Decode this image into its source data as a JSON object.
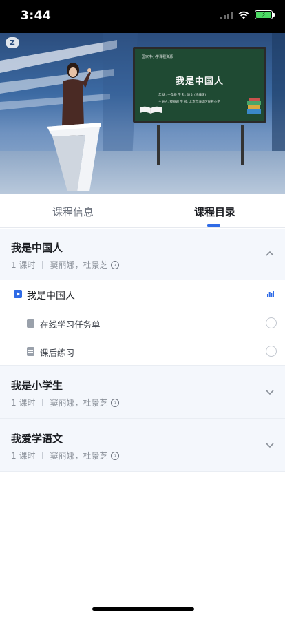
{
  "status_bar": {
    "time": "3:44",
    "battery_color": "#4cd964"
  },
  "video": {
    "board_header": "国家中小学课程资源",
    "board_title": "我是中国人",
    "board_line1": "年 级: 一年级    学 科: 语文 (统编版)",
    "board_line2": "主讲人: 窦丽娜    学 校: 北京市海淀区民族小学",
    "logo_glyph": "Z"
  },
  "tabs": {
    "info_label": "课程信息",
    "catalog_label": "课程目录",
    "active_tab": "课程目录",
    "accent_color": "#2f6be6"
  },
  "units": [
    {
      "title": "我是中国人",
      "lessons_count": "1 课时",
      "teachers": "窦丽娜，杜景芝",
      "expanded": true,
      "lesson": {
        "title": "我是中国人",
        "items": [
          {
            "title": "在线学习任务单"
          },
          {
            "title": "课后练习"
          }
        ]
      }
    },
    {
      "title": "我是小学生",
      "lessons_count": "1 课时",
      "teachers": "窦丽娜，杜景芝",
      "expanded": false
    },
    {
      "title": "我爱学语文",
      "lessons_count": "1 课时",
      "teachers": "窦丽娜，杜景芝",
      "expanded": false
    }
  ]
}
